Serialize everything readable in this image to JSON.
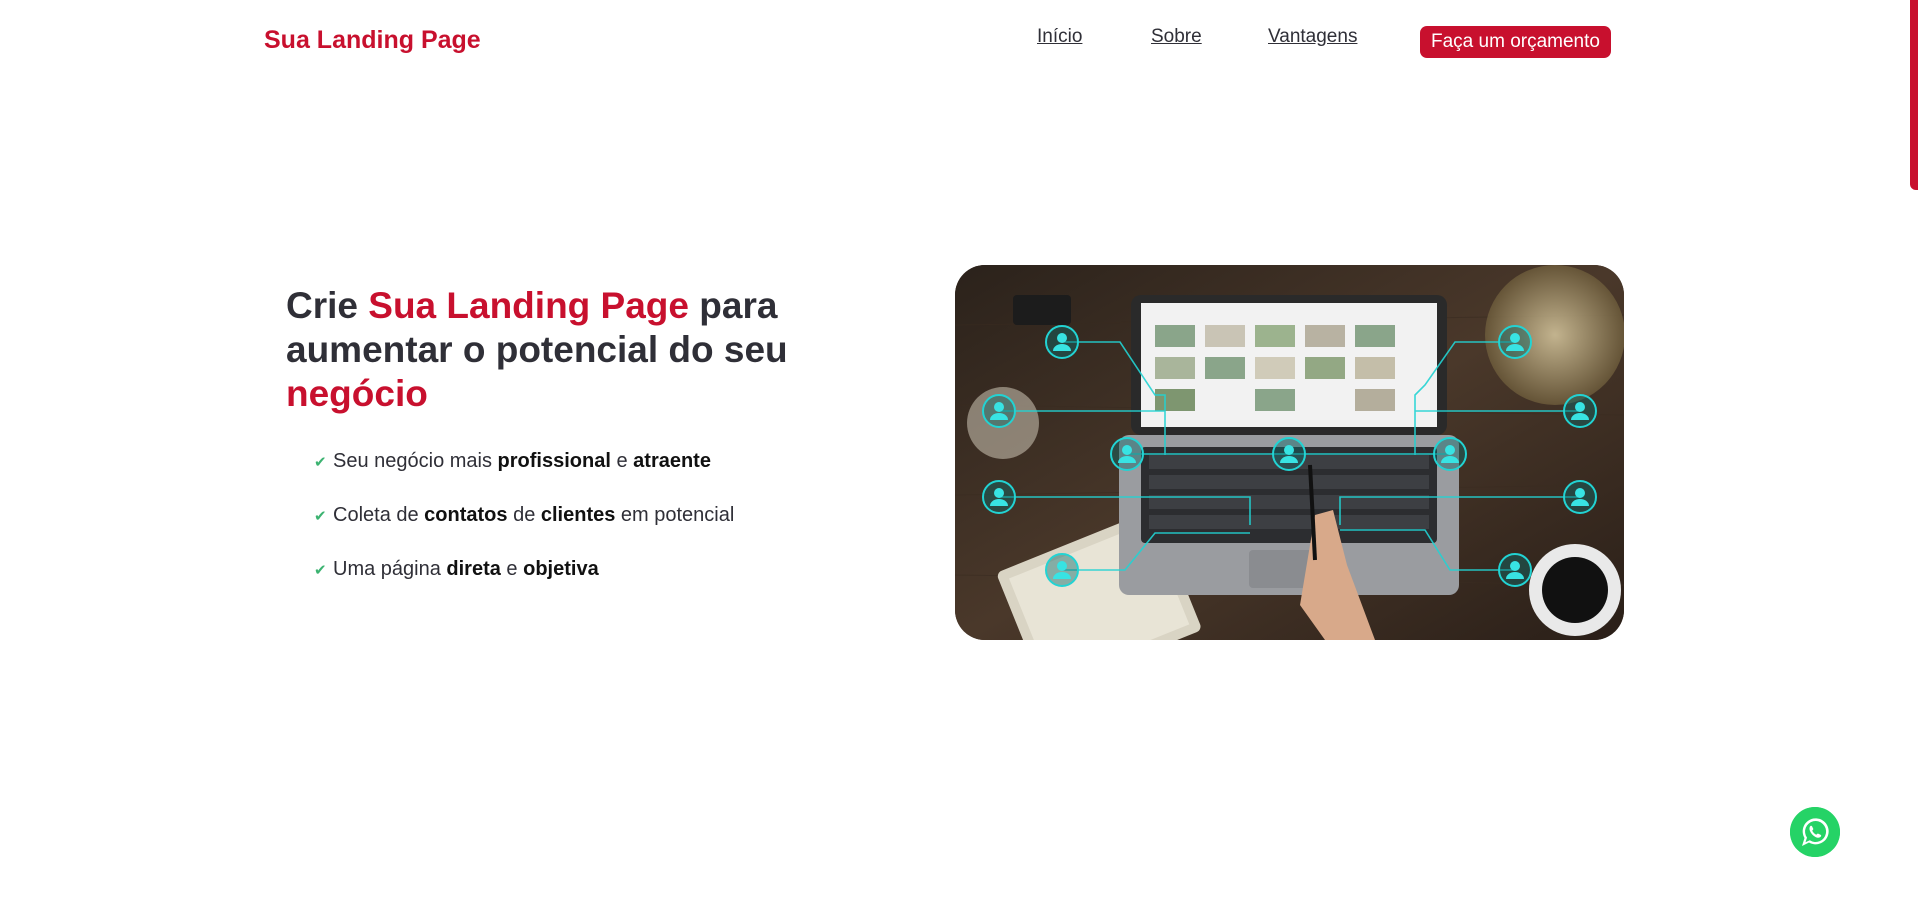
{
  "header": {
    "logo": "Sua Landing Page",
    "nav": [
      "Início",
      "Sobre",
      "Vantagens"
    ],
    "cta": "Faça um orçamento"
  },
  "hero": {
    "headline": {
      "part1": "Crie ",
      "accent1": "Sua Landing Page",
      "part2": " para aumentar o potencial do seu ",
      "accent2": "negócio"
    },
    "benefits": [
      {
        "t1": "Seu negócio mais ",
        "b1": "profissional",
        "t2": " e ",
        "b2": "atraente",
        "t3": ""
      },
      {
        "t1": "Coleta de ",
        "b1": "contatos",
        "t2": " de ",
        "b2": "clientes",
        "t3": " em potencial"
      },
      {
        "t1": "Uma página ",
        "b1": "direta",
        "t2": " e ",
        "b2": "objetiva",
        "t3": ""
      }
    ],
    "check_icon": "check-icon",
    "image": "laptop-network-photo"
  },
  "floating": {
    "whatsapp_icon": "whatsapp-icon"
  },
  "colors": {
    "accent": "#c8102e",
    "text": "#2f2f37",
    "check": "#3cb371",
    "network": "#22d3d3",
    "whatsapp": "#25d366"
  }
}
